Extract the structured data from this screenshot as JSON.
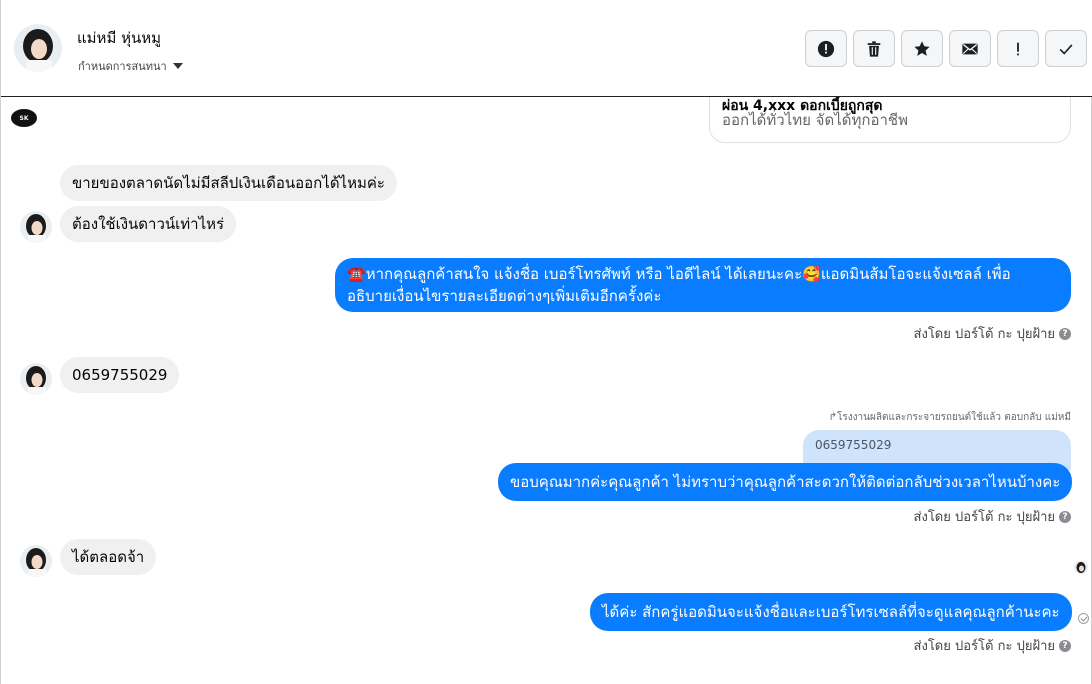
{
  "header": {
    "contact_name": "แม่หมี หุ่นหมู",
    "subtitle": "กำหนดการสนทนา"
  },
  "actions": [
    {
      "name": "report-button",
      "icon": "alert-circle-icon"
    },
    {
      "name": "delete-button",
      "icon": "trash-icon"
    },
    {
      "name": "star-button",
      "icon": "star-icon"
    },
    {
      "name": "mail-button",
      "icon": "envelope-icon"
    },
    {
      "name": "important-button",
      "icon": "exclamation-icon"
    },
    {
      "name": "done-button",
      "icon": "check-icon"
    }
  ],
  "card": {
    "line1": "ผ่อน 4,xxx ดอกเบี้ยถูกสุด",
    "line2": "ออกได้ทั่วไทย จัดได้ทุกอาชีพ"
  },
  "page_logo_text": "SK",
  "messages": {
    "in1": "ขายของตลาดนัดไม่มีสลีปเงินเดือนออกได้ไหมค่ะ",
    "in2": "ต้องใช้เงินดาวน์เท่าไหร่",
    "out1_icon": "☎️",
    "out1_line1": "หากคุณลูกค้าสนใจ แจ้งชื่อ เบอร์โทรศัพท์ หรือ ไอดีไลน์  ได้เลยนะคะ",
    "out1_emoji": "🥰",
    "out1_line1b": "แอดมินส้มโอจะแจ้งเซลล์   เพื่อ",
    "out1_line2": "อธิบายเงื่อนไขรายละเอียดต่างๆเพิ่มเติมอีกครั้งค่ะ",
    "in3": "0659755029",
    "reply_note": "โรงงานผลิตและกระจายรถยนต์ใช้แล้ว ตอบกลับ แม่หมี",
    "quoted": "0659755029",
    "out2": "ขอบคุณมากค่ะคุณลูกค้า ไม่ทราบว่าคุณลูกค้าสะดวกให้ติดต่อกลับช่วงเวลาไหนบ้างคะ",
    "in4": "ได้ตลอดจ้า",
    "out3": "ได้ค่ะ สักครู่แอดมินจะแจ้งชื่อและเบอร์โทรเซลล์ที่จะดูแลคุณลูกค้านะคะ"
  },
  "sent_by": "ส่งโดย ปอร์โต้ กะ ปุยฝ้าย",
  "help_glyph": "?"
}
